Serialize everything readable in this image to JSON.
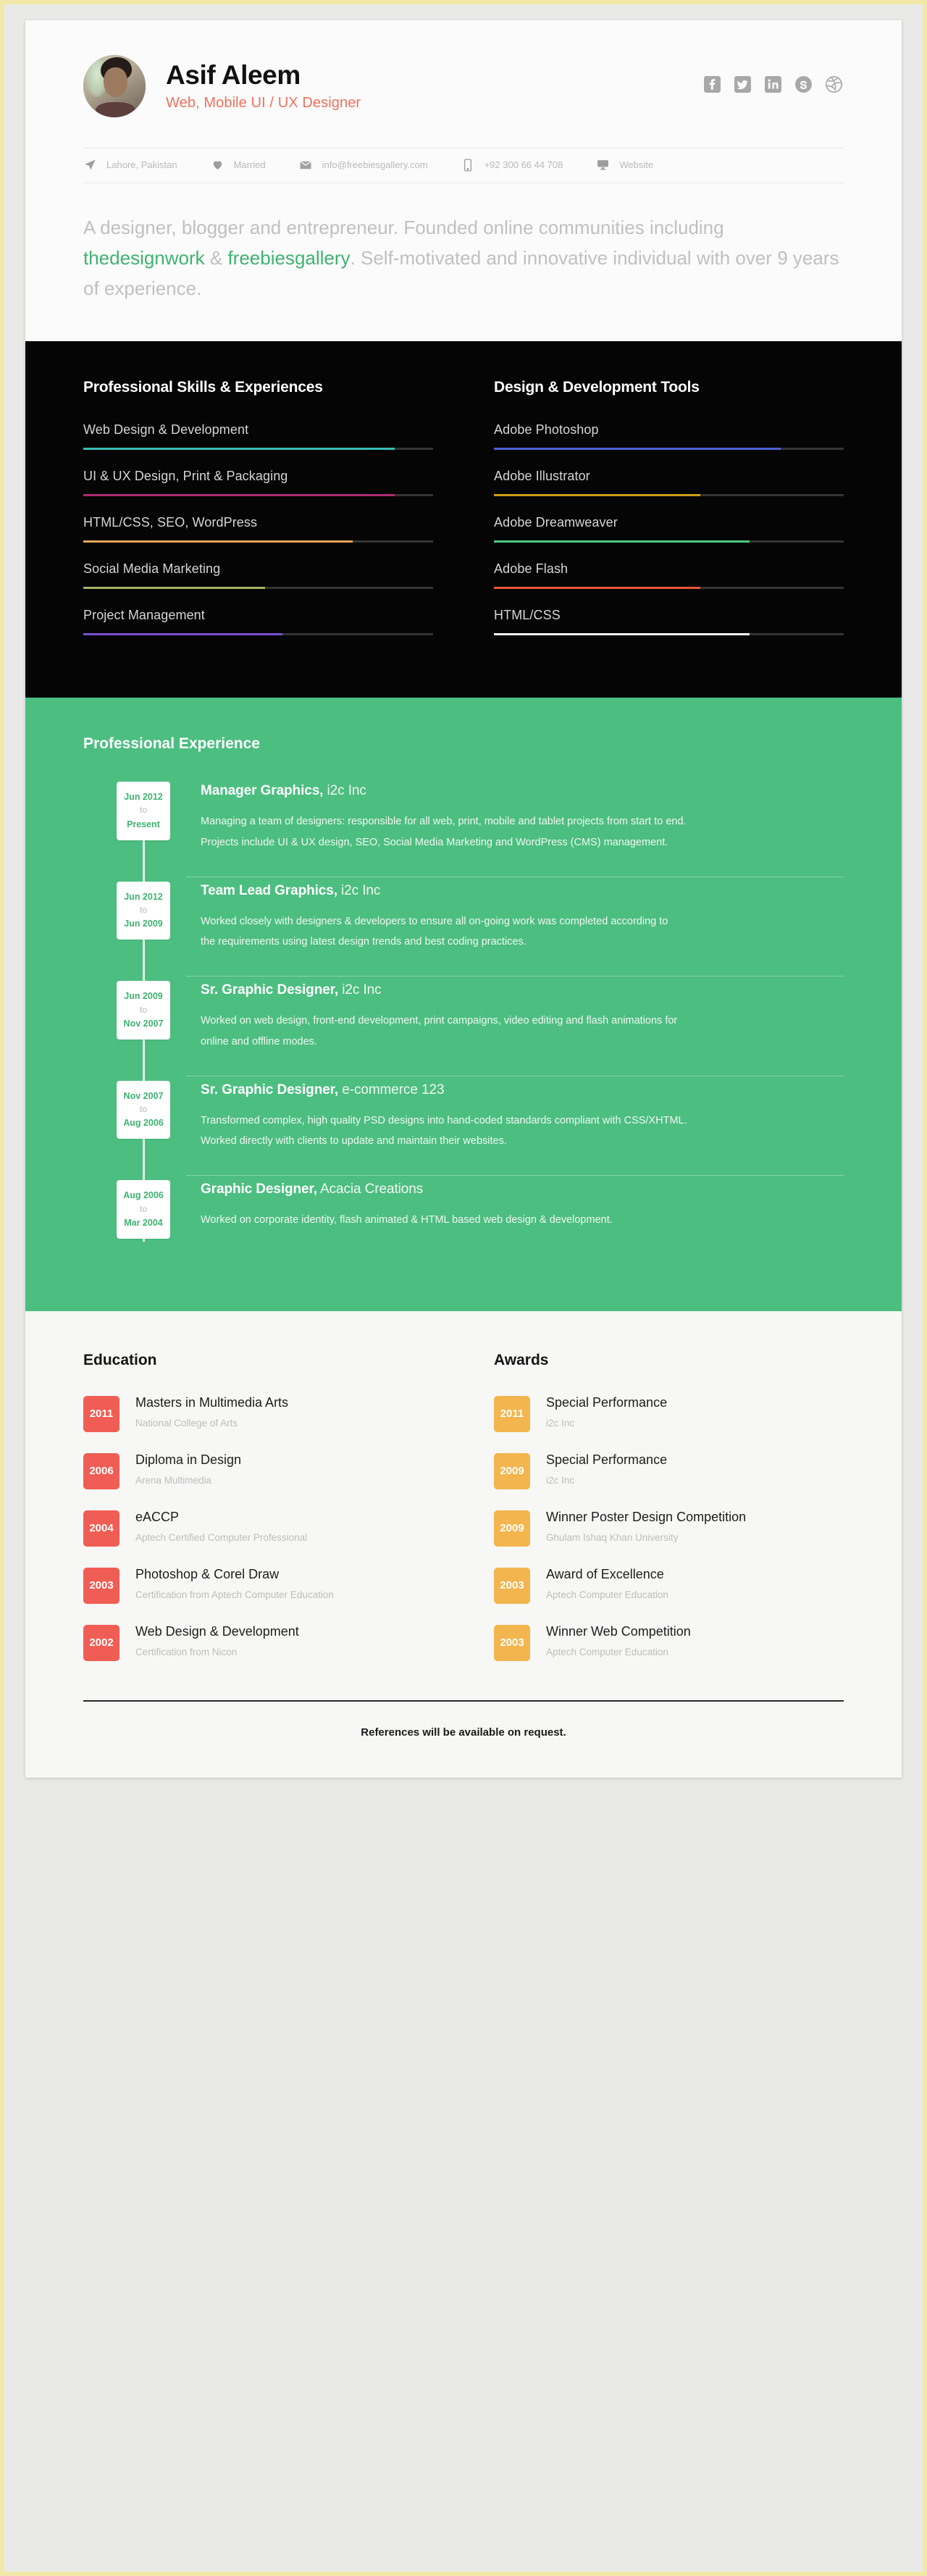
{
  "header": {
    "name": "Asif Aleem",
    "title": "Web, Mobile UI / UX Designer",
    "socials": [
      {
        "icon": "facebook-icon",
        "label": "Facebook"
      },
      {
        "icon": "twitter-icon",
        "label": "Twitter"
      },
      {
        "icon": "linkedin-icon",
        "label": "LinkedIn"
      },
      {
        "icon": "skype-icon",
        "label": "Skype"
      },
      {
        "icon": "dribbble-icon",
        "label": "Dribbble"
      }
    ],
    "contacts": [
      {
        "icon": "location-icon",
        "text": "Lahore, Pakistan"
      },
      {
        "icon": "heart-icon",
        "text": "Married"
      },
      {
        "icon": "envelope-icon",
        "text": "info@freebiesgallery.com"
      },
      {
        "icon": "mobile-icon",
        "text": "+92 300 66 44 708"
      },
      {
        "icon": "monitor-icon",
        "text": "Website"
      }
    ]
  },
  "bio": {
    "part1": "A designer, blogger and entrepreneur. Founded online communities including ",
    "link1": "thedesignwork",
    "mid": " & ",
    "link2": "freebiesgallery",
    "part2": ". Self-motivated and innovative individual with over 9 years of experience."
  },
  "skills": {
    "left_title": "Professional Skills & Experiences",
    "right_title": "Design & Development Tools",
    "left_items": [
      {
        "label": "Web Design & Development",
        "percent": 89,
        "color": "#34bfb5"
      },
      {
        "label": "UI & UX Design, Print & Packaging",
        "percent": 89,
        "color": "#b02b70"
      },
      {
        "label": "HTML/CSS, SEO, WordPress",
        "percent": 77,
        "color": "#eda45e"
      },
      {
        "label": "Social Media Marketing",
        "percent": 52,
        "color": "#a6b264"
      },
      {
        "label": "Project Management",
        "percent": 57,
        "color": "#7a4fd4"
      }
    ],
    "right_items": [
      {
        "label": "Adobe Photoshop",
        "percent": 82,
        "color": "#4c63d8"
      },
      {
        "label": "Adobe Illustrator",
        "percent": 59,
        "color": "#cca017"
      },
      {
        "label": "Adobe Dreamweaver",
        "percent": 73,
        "color": "#4fca86"
      },
      {
        "label": "Adobe Flash",
        "percent": 59,
        "color": "#ef5434"
      },
      {
        "label": "HTML/CSS",
        "percent": 73,
        "color": "#f0f0f0"
      }
    ]
  },
  "experience": {
    "title": "Professional Experience",
    "separator": "to",
    "items": [
      {
        "from": "Jun 2012",
        "to": "Present",
        "role": "Manager Graphics,",
        "company": " i2c Inc",
        "lines": [
          "Managing a team of designers: responsible for all web, print, mobile and tablet projects from start to end.",
          "Projects include UI & UX design, SEO, Social Media Marketing and WordPress (CMS) management."
        ]
      },
      {
        "from": "Jun 2012",
        "to": "Jun 2009",
        "role": "Team Lead Graphics,",
        "company": " i2c Inc",
        "lines": [
          "Worked closely with designers & developers to ensure all on-going work was completed according to",
          "the requirements using latest design trends and best coding practices."
        ]
      },
      {
        "from": "Jun 2009",
        "to": "Nov 2007",
        "role": "Sr. Graphic Designer,",
        "company": " i2c Inc",
        "lines": [
          "Worked on web design, front-end development, print campaigns, video editing and flash animations for",
          "online and offline modes."
        ]
      },
      {
        "from": "Nov 2007",
        "to": "Aug 2006",
        "role": "Sr. Graphic Designer,",
        "company": " e-commerce 123",
        "lines": [
          "Transformed complex, high quality PSD designs into hand-coded standards compliant with CSS/XHTML.",
          "Worked directly with clients to update and maintain their websites."
        ]
      },
      {
        "from": "Aug 2006",
        "to": "Mar 2004",
        "role": "Graphic Designer,",
        "company": " Acacia Creations",
        "lines": [
          "Worked on corporate identity, flash animated & HTML based web design & development."
        ]
      }
    ]
  },
  "education": {
    "title": "Education",
    "items": [
      {
        "year": "2011",
        "title": "Masters in Multimedia Arts",
        "sub": "National College of Arts"
      },
      {
        "year": "2006",
        "title": "Diploma in Design",
        "sub": "Arena Multimedia"
      },
      {
        "year": "2004",
        "title": "eACCP",
        "sub": "Aptech Certified Computer Professional"
      },
      {
        "year": "2003",
        "title": "Photoshop & Corel Draw",
        "sub": "Certification from Aptech Computer Education"
      },
      {
        "year": "2002",
        "title": "Web Design & Development",
        "sub": "Certification from Nicon"
      }
    ]
  },
  "awards": {
    "title": "Awards",
    "items": [
      {
        "year": "2011",
        "title": "Special Performance",
        "sub": "i2c Inc"
      },
      {
        "year": "2009",
        "title": "Special Performance",
        "sub": "i2c Inc"
      },
      {
        "year": "2009",
        "title": "Winner Poster Design Competition",
        "sub": "Ghulam Ishaq Khan University"
      },
      {
        "year": "2003",
        "title": "Award of Excellence",
        "sub": "Aptech Computer Education"
      },
      {
        "year": "2003",
        "title": "Winner Web Competition",
        "sub": "Aptech Computer Education"
      }
    ]
  },
  "footer": {
    "note": "References will be available on request."
  },
  "colors": {
    "accent_green": "#4cbe80",
    "accent_coral": "#f1705c",
    "edu_badge": "#f05d54",
    "award_badge": "#f3b54d",
    "skills_bg": "#050505"
  }
}
